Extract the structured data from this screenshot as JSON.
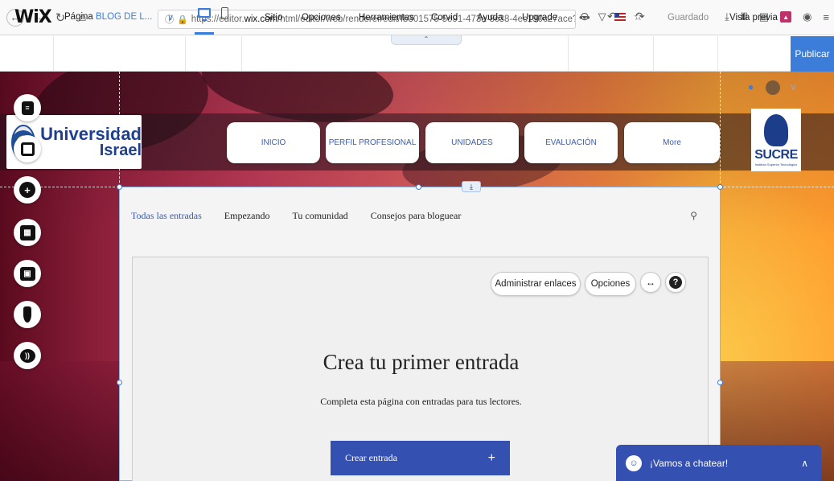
{
  "browser": {
    "url_prefix": "https://editor.",
    "url_domain": "wix.com",
    "url_rest": "/html/editor/web/renderer/edit/fb301575-5e91-473a-8c38-4ec190c27ace?",
    "more": "•••"
  },
  "wix": {
    "logo": "WiX",
    "page_label": "Página",
    "page_name": "BLOG DE L...",
    "menu": [
      "Sitio",
      "Opciones",
      "Herramientas",
      "Corvid",
      "Ayuda",
      "Upgrade"
    ],
    "saved": "Guardado",
    "preview": "Vista previa",
    "publish": "Publicar"
  },
  "site": {
    "logo_line1": "Universidad",
    "logo_line2": "Israel",
    "nav": [
      "INICIO",
      "PERFIL PROFESIONAL",
      "UNIDADES",
      "EVALUACIÓN",
      "More"
    ],
    "sucre": "SUCRE",
    "sucre_sub": "Instituto Superior Tecnológico"
  },
  "blog": {
    "tabs": [
      "Todas las entradas",
      "Empezando",
      "Tu comunidad",
      "Consejos para bloguear"
    ],
    "manage_links": "Administrar enlaces",
    "options": "Opciones",
    "empty_title": "Crea tu primer entrada",
    "empty_sub": "Completa esta página con entradas para tus lectores.",
    "create_label": "Crear entrada",
    "create_plus": "+"
  },
  "chat": {
    "label": "¡Vamos a chatear!"
  },
  "colors": {
    "wix_blue": "#3b7dd8",
    "blog_button": "#3450b0"
  }
}
